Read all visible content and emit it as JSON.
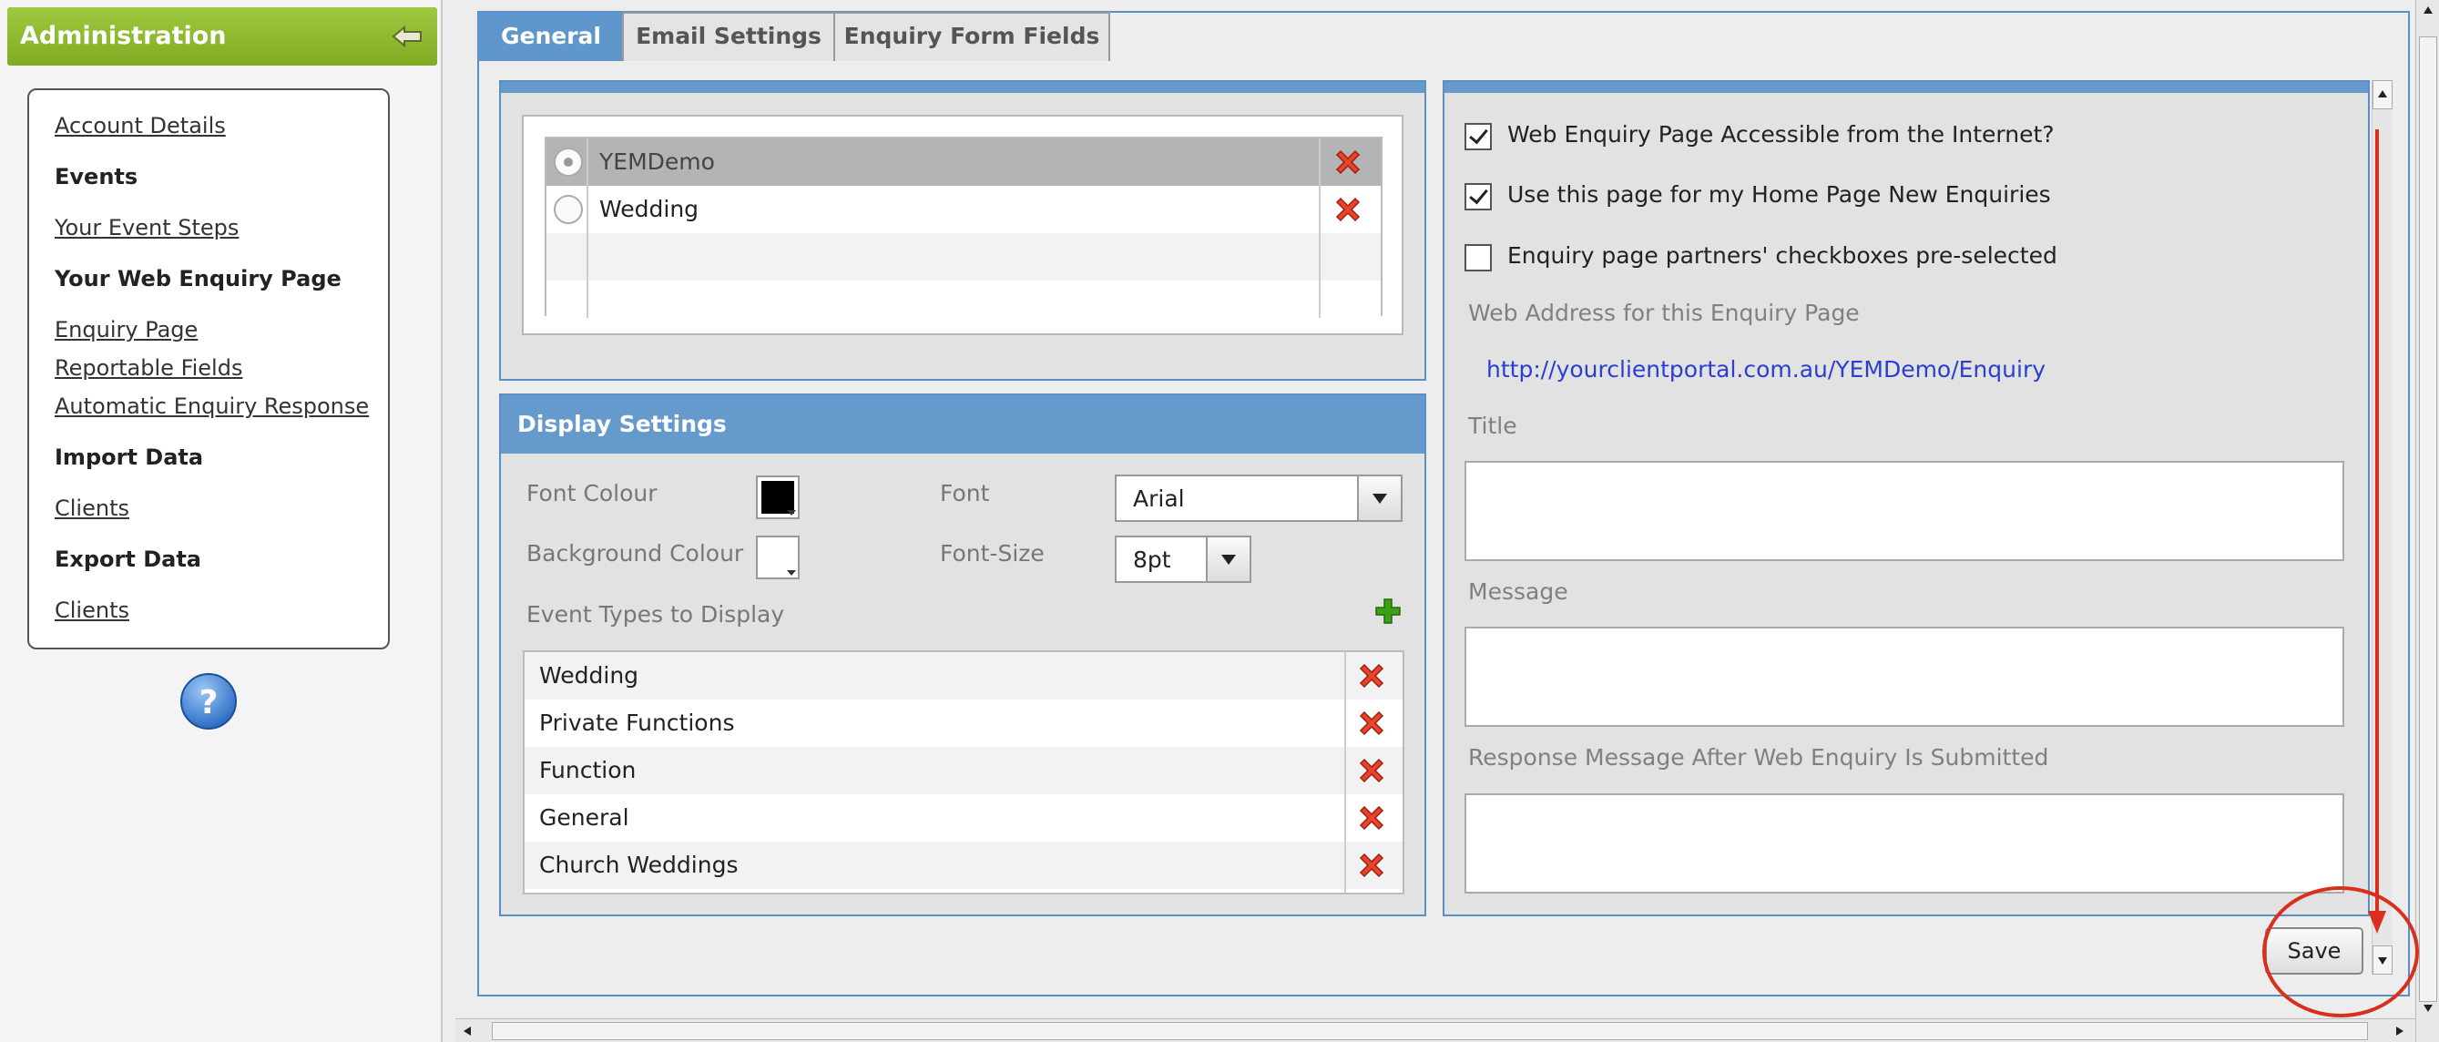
{
  "sidebar": {
    "title": "Administration",
    "nav": [
      {
        "label": "Account Details",
        "type": "link"
      },
      {
        "label": "Events",
        "type": "heading"
      },
      {
        "label": "Your Event Steps",
        "type": "link"
      },
      {
        "label": "Your Web Enquiry Page",
        "type": "heading"
      },
      {
        "label": "Enquiry Page",
        "type": "link"
      },
      {
        "label": "Reportable Fields",
        "type": "link"
      },
      {
        "label": "Automatic Enquiry Response",
        "type": "link"
      },
      {
        "label": "Import Data",
        "type": "heading"
      },
      {
        "label": "Clients",
        "type": "link"
      },
      {
        "label": "Export Data",
        "type": "heading"
      },
      {
        "label": "Clients",
        "type": "link"
      }
    ],
    "help_icon": "question-icon"
  },
  "tabs": [
    {
      "label": "General",
      "active": true
    },
    {
      "label": "Email Settings",
      "active": false
    },
    {
      "label": "Enquiry Form Fields",
      "active": false
    }
  ],
  "enquiry_pages": {
    "rows": [
      {
        "label": "YEMDemo",
        "selected": true
      },
      {
        "label": "Wedding",
        "selected": false
      }
    ]
  },
  "display_settings": {
    "title": "Display Settings",
    "font_colour_label": "Font Colour",
    "font_colour": "#000000",
    "background_colour_label": "Background Colour",
    "background_colour": "#ffffff",
    "font_label": "Font",
    "font_value": "Arial",
    "font_size_label": "Font-Size",
    "font_size_value": "8pt",
    "event_types_label": "Event Types to Display",
    "event_types": [
      "Wedding",
      "Private Functions",
      "Function",
      "General",
      "Church Weddings"
    ]
  },
  "page_settings": {
    "accessible": {
      "label": "Web Enquiry Page Accessible from the Internet?",
      "checked": true
    },
    "home_page": {
      "label": "Use this page for my Home Page New Enquiries",
      "checked": true
    },
    "partners": {
      "label": "Enquiry page partners' checkboxes pre-selected",
      "checked": false
    },
    "web_address_label": "Web Address for this Enquiry Page",
    "web_address": "http://yourclientportal.com.au/YEMDemo/Enquiry",
    "title_label": "Title",
    "title_value": "",
    "message_label": "Message",
    "message_value": "",
    "response_label": "Response Message After Web Enquiry Is Submitted",
    "response_value": ""
  },
  "save_label": "Save",
  "colors": {
    "header_green": "#8fbb2f",
    "tab_blue": "#5f96cc",
    "panel_blue": "#6699cc",
    "delete_red": "#e8442a",
    "add_green": "#3aa018",
    "annotation_red": "#d8301c",
    "link_blue": "#2a3fd1"
  }
}
